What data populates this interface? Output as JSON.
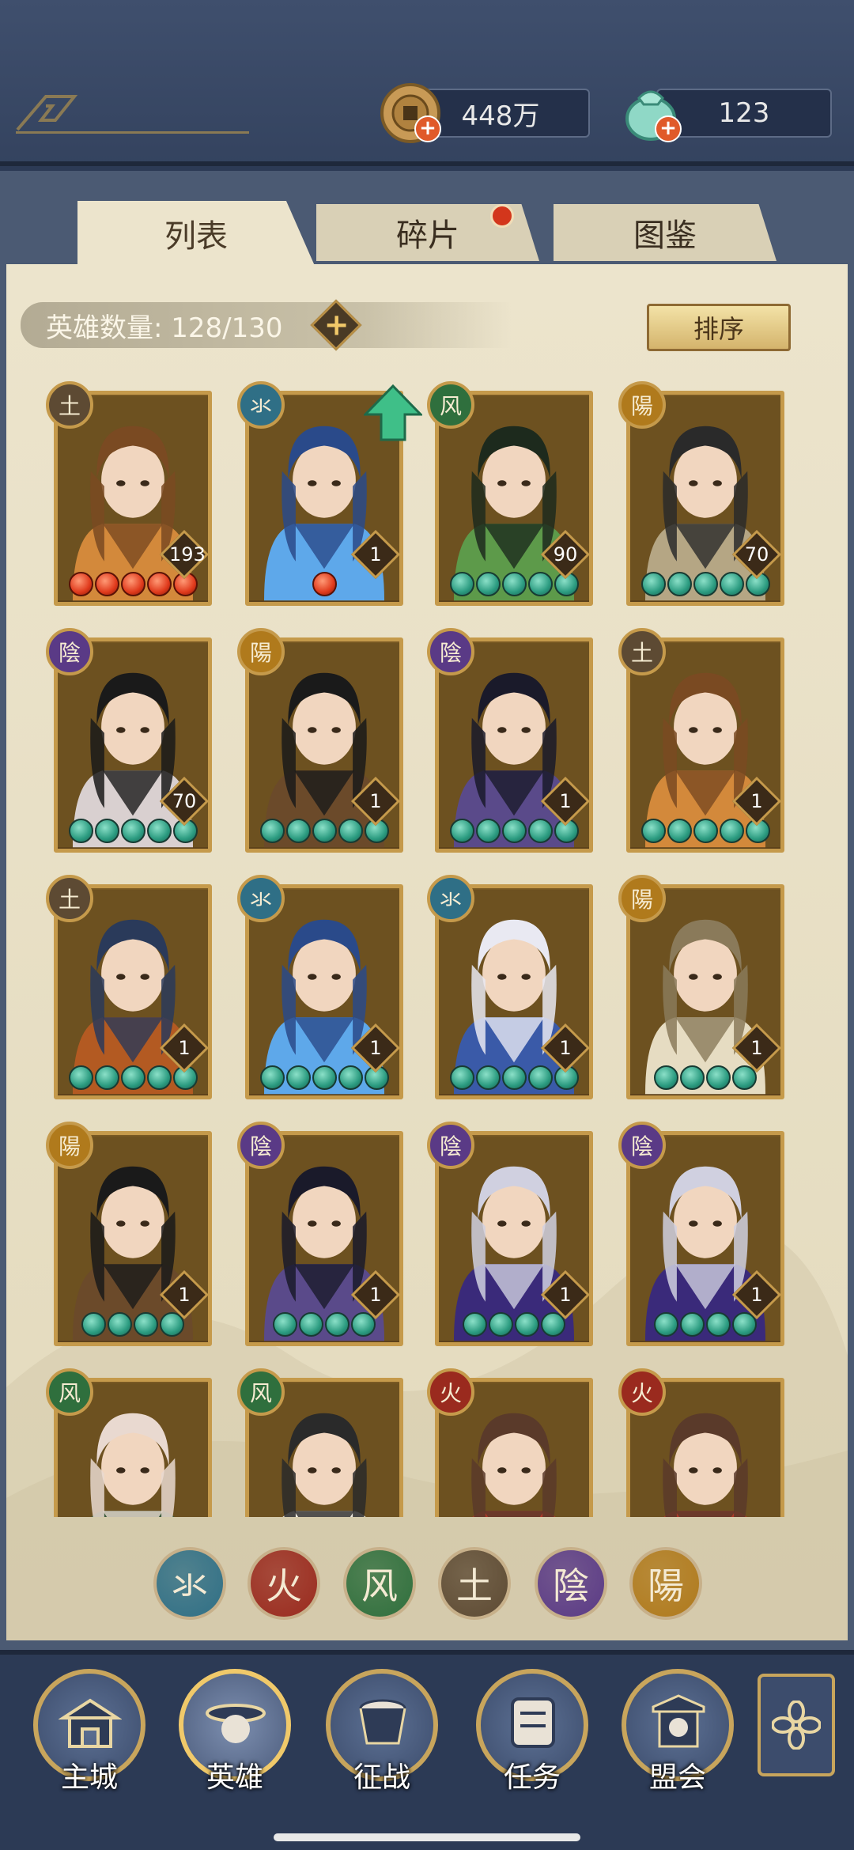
{
  "resources": {
    "coins": "448万",
    "jade": "123"
  },
  "tabs": [
    {
      "label": "列表",
      "active": true
    },
    {
      "label": "碎片",
      "active": false,
      "badge": true
    },
    {
      "label": "图鉴",
      "active": false
    }
  ],
  "hero_count_label": "英雄数量: 128/130",
  "add_label": "+",
  "sort_label": "排序",
  "elements": {
    "water": {
      "glyph": "氺",
      "color": "#2f6f86"
    },
    "fire": {
      "glyph": "火",
      "color": "#9a2a1e"
    },
    "wind": {
      "glyph": "风",
      "color": "#2f6f3d"
    },
    "earth": {
      "glyph": "土",
      "color": "#5d4a33"
    },
    "yin": {
      "glyph": "陰",
      "color": "#5a3a86"
    },
    "yang": {
      "glyph": "陽",
      "color": "#b07a1c"
    }
  },
  "heroes": [
    {
      "element": "earth",
      "stars": 5,
      "star_type": "red",
      "level": "193",
      "palette": [
        "#d3893b",
        "#7a4a22"
      ]
    },
    {
      "element": "water",
      "stars": 1,
      "star_type": "red",
      "level": "1",
      "palette": [
        "#5ea8ea",
        "#2a4a8a"
      ],
      "upgrade": true
    },
    {
      "element": "wind",
      "stars": 5,
      "star_type": "jade",
      "level": "90",
      "palette": [
        "#5d9a4a",
        "#1d2a1d"
      ]
    },
    {
      "element": "yang",
      "stars": 5,
      "star_type": "jade",
      "level": "70",
      "palette": [
        "#b5a684",
        "#2a2a2a"
      ]
    },
    {
      "element": "yin",
      "stars": 5,
      "star_type": "jade",
      "level": "70",
      "palette": [
        "#d9d0d0",
        "#1a1a1a"
      ]
    },
    {
      "element": "yang",
      "stars": 5,
      "star_type": "jade",
      "level": "1",
      "palette": [
        "#6b4a2a",
        "#1a1a1a"
      ]
    },
    {
      "element": "yin",
      "stars": 5,
      "star_type": "jade",
      "level": "1",
      "palette": [
        "#5a4a8a",
        "#1a1a2a"
      ]
    },
    {
      "element": "earth",
      "stars": 5,
      "star_type": "jade",
      "level": "1",
      "palette": [
        "#d3893b",
        "#7a4a22"
      ]
    },
    {
      "element": "earth",
      "stars": 5,
      "star_type": "jade",
      "level": "1",
      "palette": [
        "#b35a22",
        "#2a3a5a"
      ]
    },
    {
      "element": "water",
      "stars": 5,
      "star_type": "jade",
      "level": "1",
      "palette": [
        "#5ea8ea",
        "#2a4a8a"
      ]
    },
    {
      "element": "water",
      "stars": 5,
      "star_type": "jade",
      "level": "1",
      "palette": [
        "#3a5aa8",
        "#e9e9f2"
      ]
    },
    {
      "element": "yang",
      "stars": 4,
      "star_type": "jade",
      "level": "1",
      "palette": [
        "#e6dcc2",
        "#8a7a5a"
      ]
    },
    {
      "element": "yang",
      "stars": 4,
      "star_type": "jade",
      "level": "1",
      "palette": [
        "#6b4a2a",
        "#1a1a1a"
      ]
    },
    {
      "element": "yin",
      "stars": 4,
      "star_type": "jade",
      "level": "1",
      "palette": [
        "#5a4a8a",
        "#1a1a2a"
      ]
    },
    {
      "element": "yin",
      "stars": 4,
      "star_type": "jade",
      "level": "1",
      "palette": [
        "#3a2a7a",
        "#d0d0e0"
      ]
    },
    {
      "element": "yin",
      "stars": 4,
      "star_type": "jade",
      "level": "1",
      "palette": [
        "#3a2a7a",
        "#d0d0e0"
      ]
    },
    {
      "element": "wind",
      "stars": 0,
      "star_type": "jade",
      "level": "",
      "palette": [
        "#3a5a3a",
        "#e9d9d0"
      ]
    },
    {
      "element": "wind",
      "stars": 0,
      "star_type": "jade",
      "level": "",
      "palette": [
        "#f0ece2",
        "#2a2a2a"
      ]
    },
    {
      "element": "fire",
      "stars": 0,
      "star_type": "jade",
      "level": "",
      "palette": [
        "#b03a2a",
        "#5a3a2a"
      ]
    },
    {
      "element": "fire",
      "stars": 0,
      "star_type": "jade",
      "level": "",
      "palette": [
        "#b03a2a",
        "#5a3a2a"
      ]
    }
  ],
  "filters": [
    "water",
    "fire",
    "wind",
    "earth",
    "yin",
    "yang"
  ],
  "nav": [
    {
      "label": "主城",
      "icon": "palace-icon"
    },
    {
      "label": "英雄",
      "icon": "hero-icon",
      "active": true
    },
    {
      "label": "征战",
      "icon": "battle-drum-icon"
    },
    {
      "label": "任务",
      "icon": "scroll-icon"
    },
    {
      "label": "盟会",
      "icon": "alliance-icon"
    }
  ],
  "side_button_icon": "flower-menu-icon"
}
